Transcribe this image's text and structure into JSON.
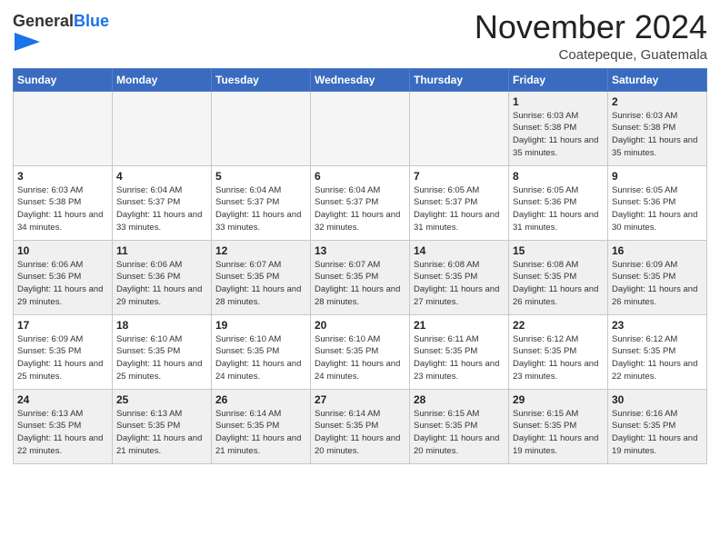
{
  "header": {
    "logo_general": "General",
    "logo_blue": "Blue",
    "month": "November 2024",
    "location": "Coatepeque, Guatemala"
  },
  "weekdays": [
    "Sunday",
    "Monday",
    "Tuesday",
    "Wednesday",
    "Thursday",
    "Friday",
    "Saturday"
  ],
  "weeks": [
    [
      {
        "day": "",
        "info": ""
      },
      {
        "day": "",
        "info": ""
      },
      {
        "day": "",
        "info": ""
      },
      {
        "day": "",
        "info": ""
      },
      {
        "day": "",
        "info": ""
      },
      {
        "day": "1",
        "info": "Sunrise: 6:03 AM\nSunset: 5:38 PM\nDaylight: 11 hours\nand 35 minutes."
      },
      {
        "day": "2",
        "info": "Sunrise: 6:03 AM\nSunset: 5:38 PM\nDaylight: 11 hours\nand 35 minutes."
      }
    ],
    [
      {
        "day": "3",
        "info": "Sunrise: 6:03 AM\nSunset: 5:38 PM\nDaylight: 11 hours\nand 34 minutes."
      },
      {
        "day": "4",
        "info": "Sunrise: 6:04 AM\nSunset: 5:37 PM\nDaylight: 11 hours\nand 33 minutes."
      },
      {
        "day": "5",
        "info": "Sunrise: 6:04 AM\nSunset: 5:37 PM\nDaylight: 11 hours\nand 33 minutes."
      },
      {
        "day": "6",
        "info": "Sunrise: 6:04 AM\nSunset: 5:37 PM\nDaylight: 11 hours\nand 32 minutes."
      },
      {
        "day": "7",
        "info": "Sunrise: 6:05 AM\nSunset: 5:37 PM\nDaylight: 11 hours\nand 31 minutes."
      },
      {
        "day": "8",
        "info": "Sunrise: 6:05 AM\nSunset: 5:36 PM\nDaylight: 11 hours\nand 31 minutes."
      },
      {
        "day": "9",
        "info": "Sunrise: 6:05 AM\nSunset: 5:36 PM\nDaylight: 11 hours\nand 30 minutes."
      }
    ],
    [
      {
        "day": "10",
        "info": "Sunrise: 6:06 AM\nSunset: 5:36 PM\nDaylight: 11 hours\nand 29 minutes."
      },
      {
        "day": "11",
        "info": "Sunrise: 6:06 AM\nSunset: 5:36 PM\nDaylight: 11 hours\nand 29 minutes."
      },
      {
        "day": "12",
        "info": "Sunrise: 6:07 AM\nSunset: 5:35 PM\nDaylight: 11 hours\nand 28 minutes."
      },
      {
        "day": "13",
        "info": "Sunrise: 6:07 AM\nSunset: 5:35 PM\nDaylight: 11 hours\nand 28 minutes."
      },
      {
        "day": "14",
        "info": "Sunrise: 6:08 AM\nSunset: 5:35 PM\nDaylight: 11 hours\nand 27 minutes."
      },
      {
        "day": "15",
        "info": "Sunrise: 6:08 AM\nSunset: 5:35 PM\nDaylight: 11 hours\nand 26 minutes."
      },
      {
        "day": "16",
        "info": "Sunrise: 6:09 AM\nSunset: 5:35 PM\nDaylight: 11 hours\nand 26 minutes."
      }
    ],
    [
      {
        "day": "17",
        "info": "Sunrise: 6:09 AM\nSunset: 5:35 PM\nDaylight: 11 hours\nand 25 minutes."
      },
      {
        "day": "18",
        "info": "Sunrise: 6:10 AM\nSunset: 5:35 PM\nDaylight: 11 hours\nand 25 minutes."
      },
      {
        "day": "19",
        "info": "Sunrise: 6:10 AM\nSunset: 5:35 PM\nDaylight: 11 hours\nand 24 minutes."
      },
      {
        "day": "20",
        "info": "Sunrise: 6:10 AM\nSunset: 5:35 PM\nDaylight: 11 hours\nand 24 minutes."
      },
      {
        "day": "21",
        "info": "Sunrise: 6:11 AM\nSunset: 5:35 PM\nDaylight: 11 hours\nand 23 minutes."
      },
      {
        "day": "22",
        "info": "Sunrise: 6:12 AM\nSunset: 5:35 PM\nDaylight: 11 hours\nand 23 minutes."
      },
      {
        "day": "23",
        "info": "Sunrise: 6:12 AM\nSunset: 5:35 PM\nDaylight: 11 hours\nand 22 minutes."
      }
    ],
    [
      {
        "day": "24",
        "info": "Sunrise: 6:13 AM\nSunset: 5:35 PM\nDaylight: 11 hours\nand 22 minutes."
      },
      {
        "day": "25",
        "info": "Sunrise: 6:13 AM\nSunset: 5:35 PM\nDaylight: 11 hours\nand 21 minutes."
      },
      {
        "day": "26",
        "info": "Sunrise: 6:14 AM\nSunset: 5:35 PM\nDaylight: 11 hours\nand 21 minutes."
      },
      {
        "day": "27",
        "info": "Sunrise: 6:14 AM\nSunset: 5:35 PM\nDaylight: 11 hours\nand 20 minutes."
      },
      {
        "day": "28",
        "info": "Sunrise: 6:15 AM\nSunset: 5:35 PM\nDaylight: 11 hours\nand 20 minutes."
      },
      {
        "day": "29",
        "info": "Sunrise: 6:15 AM\nSunset: 5:35 PM\nDaylight: 11 hours\nand 19 minutes."
      },
      {
        "day": "30",
        "info": "Sunrise: 6:16 AM\nSunset: 5:35 PM\nDaylight: 11 hours\nand 19 minutes."
      }
    ]
  ]
}
